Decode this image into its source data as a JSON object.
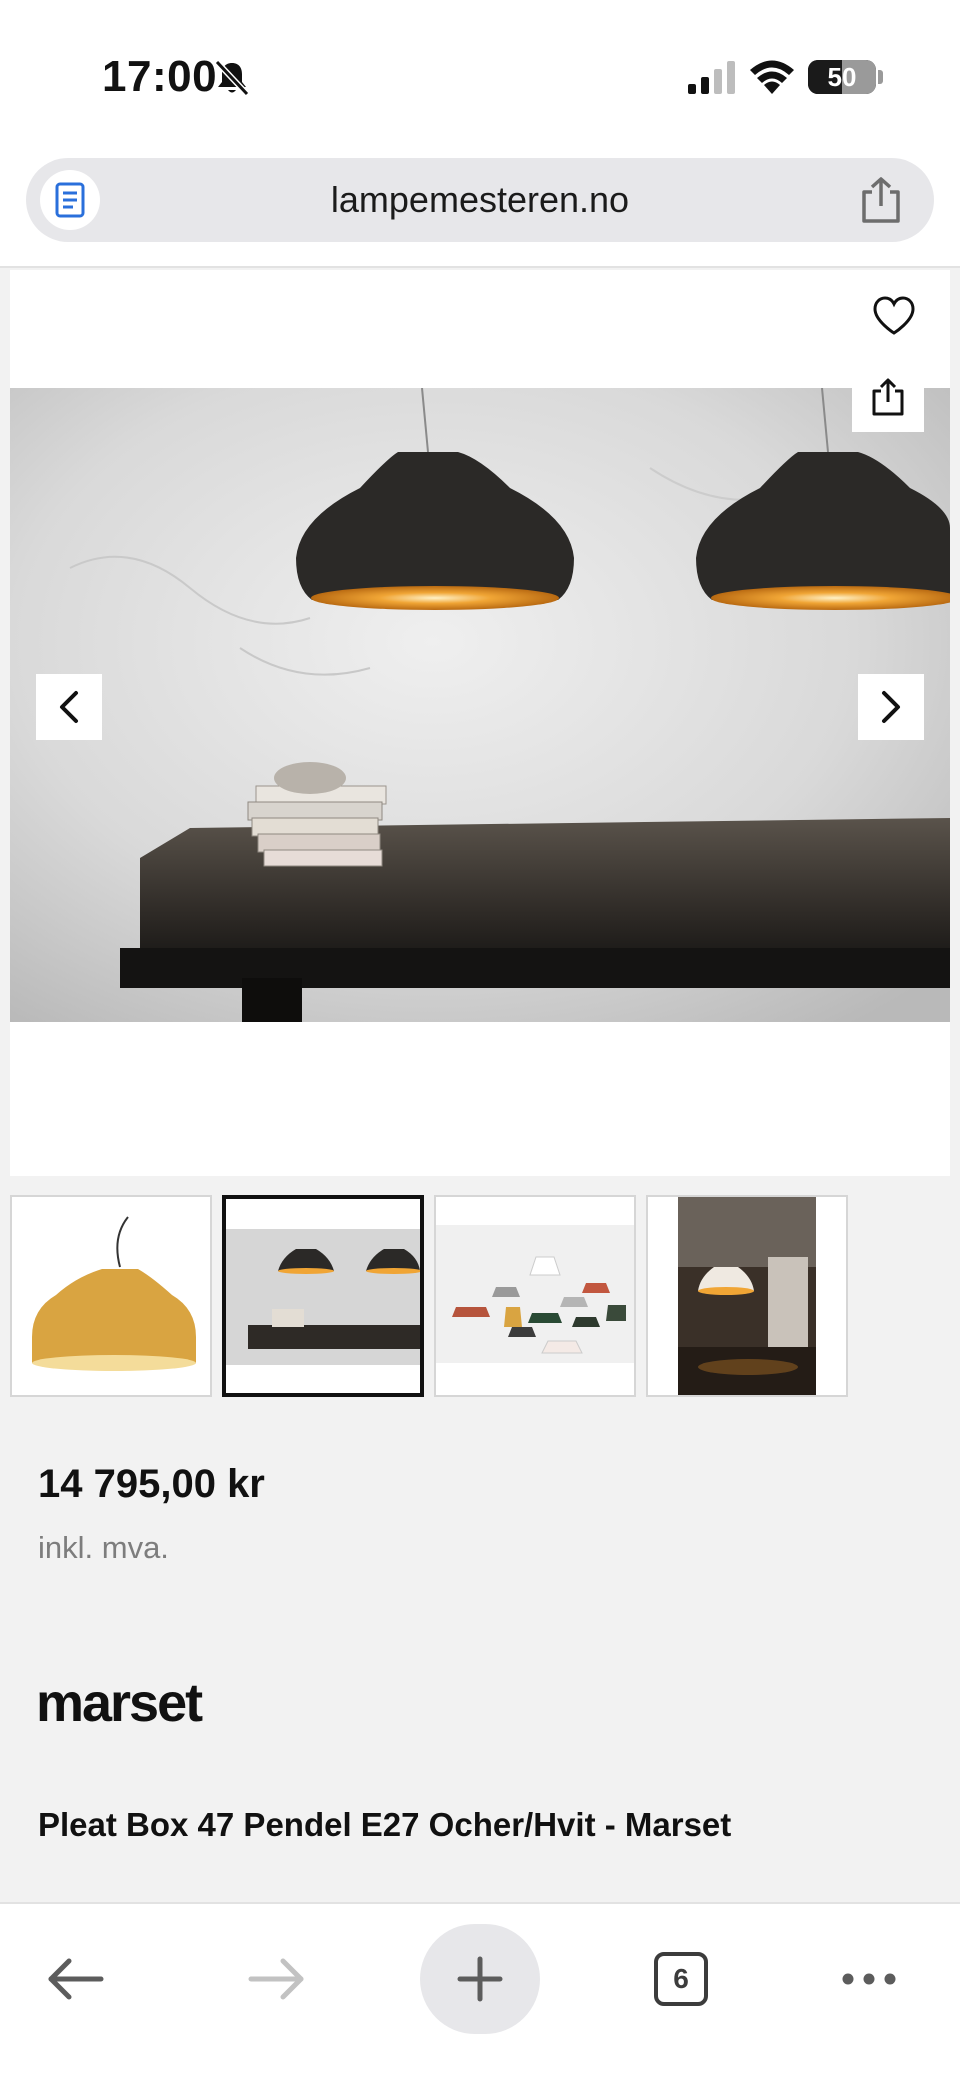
{
  "status_bar": {
    "time": "17:00",
    "battery_percent": 50,
    "battery_label": "50",
    "icons": [
      "bell-slash-icon",
      "cellular-signal-icon",
      "wifi-icon",
      "battery-icon"
    ]
  },
  "browser": {
    "url": "lampemesteren.no",
    "icons": [
      "reader-mode-icon",
      "share-icon"
    ],
    "tab_count": "6",
    "toolbar_icons": [
      "back-arrow-icon",
      "forward-arrow-icon",
      "plus-icon",
      "tabs-icon",
      "more-icon"
    ]
  },
  "gallery": {
    "active_index": 1,
    "icons": [
      "heart-icon",
      "share-icon",
      "chevron-left-icon",
      "chevron-right-icon"
    ],
    "thumbnail_count": 4
  },
  "product": {
    "price": "14 795,00 kr",
    "vat_note": "inkl. mva.",
    "brand": "marset",
    "title": "Pleat Box 47 Pendel E27 Ocher/Hvit - Marset"
  },
  "colors": {
    "page_bg": "#f2f2f2",
    "ocher": "#d9a441",
    "lamp_black": "#2b2927",
    "gold_inner": "#e89a2a"
  }
}
